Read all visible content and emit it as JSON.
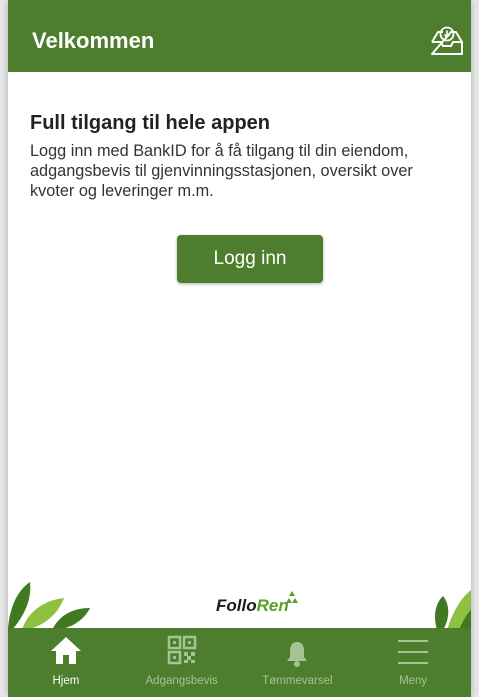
{
  "header": {
    "title": "Velkommen",
    "icon": "inbox-download-icon"
  },
  "main": {
    "heading": "Full tilgang til hele appen",
    "description": "Logg inn med BankID for å få tilgang til din eiendom, adgangsbevis til gjenvinningsstasjonen, oversikt over kvoter og leveringer m.m.",
    "login_button": "Logg inn"
  },
  "footer": {
    "logo_part1": "Follo",
    "logo_part2": "Ren"
  },
  "tabs": [
    {
      "label": "Hjem",
      "icon": "home-icon",
      "active": true
    },
    {
      "label": "Adgangsbevis",
      "icon": "qr-code-icon",
      "active": false
    },
    {
      "label": "Tømmevarsel",
      "icon": "bell-icon",
      "active": false
    },
    {
      "label": "Meny",
      "icon": "menu-icon",
      "active": false
    }
  ],
  "colors": {
    "brand_green": "#4c7e2e",
    "logo_green": "#5a9e2e",
    "tab_inactive": "#a6c393"
  }
}
